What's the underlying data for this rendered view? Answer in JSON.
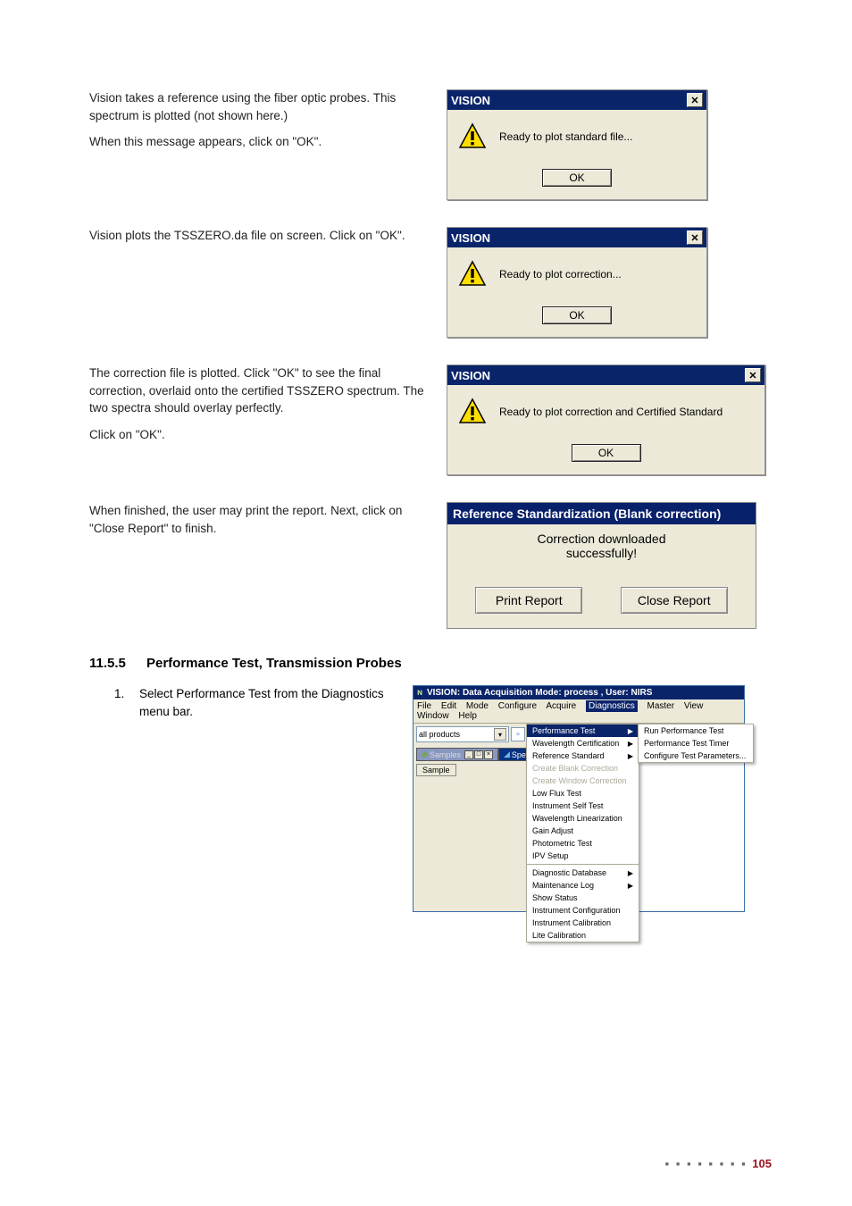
{
  "rows": [
    {
      "para1": "Vision takes a reference using the fiber optic probes. This spectrum is plotted (not shown here.)",
      "para2": "When this message appears, click on \"OK\".",
      "dlg": {
        "title": "VISION",
        "msg": "Ready to plot standard file...",
        "ok": "OK"
      }
    },
    {
      "para1": "Vision plots the TSSZERO.da file on screen. Click on \"OK\".",
      "dlg": {
        "title": "VISION",
        "msg": "Ready to plot correction...",
        "ok": "OK"
      }
    },
    {
      "para1": "The correction file is plotted. Click \"OK\" to see the final correction, overlaid onto the certified TSSZERO spectrum. The two spectra should overlay perfectly.",
      "para2": "Click on \"OK\".",
      "dlg": {
        "title": "VISION",
        "msg": "Ready to plot correction and Certified Standard",
        "ok": "OK"
      }
    },
    {
      "para1": "When finished, the user may print the report. Next, click on \"Close Report\" to finish.",
      "report": {
        "title": "Reference Standardization (Blank correction)",
        "line1": "Correction downloaded",
        "line2": "successfully!",
        "print": "Print Report",
        "close": "Close Report"
      }
    }
  ],
  "section": {
    "num": "11.5.5",
    "title": "Performance Test, Transmission Probes"
  },
  "step": {
    "num": "1.",
    "text": "Select Performance Test from the Diagnostics menu bar."
  },
  "app": {
    "title": "VISION: Data Acquisition Mode: process , User: NIRS",
    "menubar": [
      "File",
      "Edit",
      "Mode",
      "Configure",
      "Acquire",
      "Diagnostics",
      "Master",
      "View",
      "Window",
      "Help"
    ],
    "combo": "all products",
    "tab_samples": "Samples",
    "tab_spectra": "Spectra",
    "sample_btn": "Sample",
    "dropdown": [
      {
        "t": "Performance Test",
        "sel": true,
        "arr": true
      },
      {
        "t": "Wavelength Certification",
        "arr": true
      },
      {
        "t": "Reference Standard",
        "arr": true
      },
      {
        "t": "Create Blank Correction",
        "dis": true
      },
      {
        "t": "Create Window Correction",
        "dis": true
      },
      {
        "t": "Low Flux Test"
      },
      {
        "t": "Instrument Self Test"
      },
      {
        "t": "Wavelength Linearization"
      },
      {
        "t": "Gain Adjust"
      },
      {
        "t": "Photometric Test"
      },
      {
        "t": "IPV Setup"
      },
      {
        "hr": true
      },
      {
        "t": "Diagnostic Database",
        "arr": true
      },
      {
        "t": "Maintenance Log",
        "arr": true
      },
      {
        "t": "Show Status"
      },
      {
        "t": "Instrument Configuration"
      },
      {
        "t": "Instrument Calibration"
      },
      {
        "t": "Lite Calibration"
      }
    ],
    "submenu": [
      "Run Performance Test",
      "Performance Test Timer",
      "Configure Test Parameters..."
    ]
  },
  "page_num": "105"
}
